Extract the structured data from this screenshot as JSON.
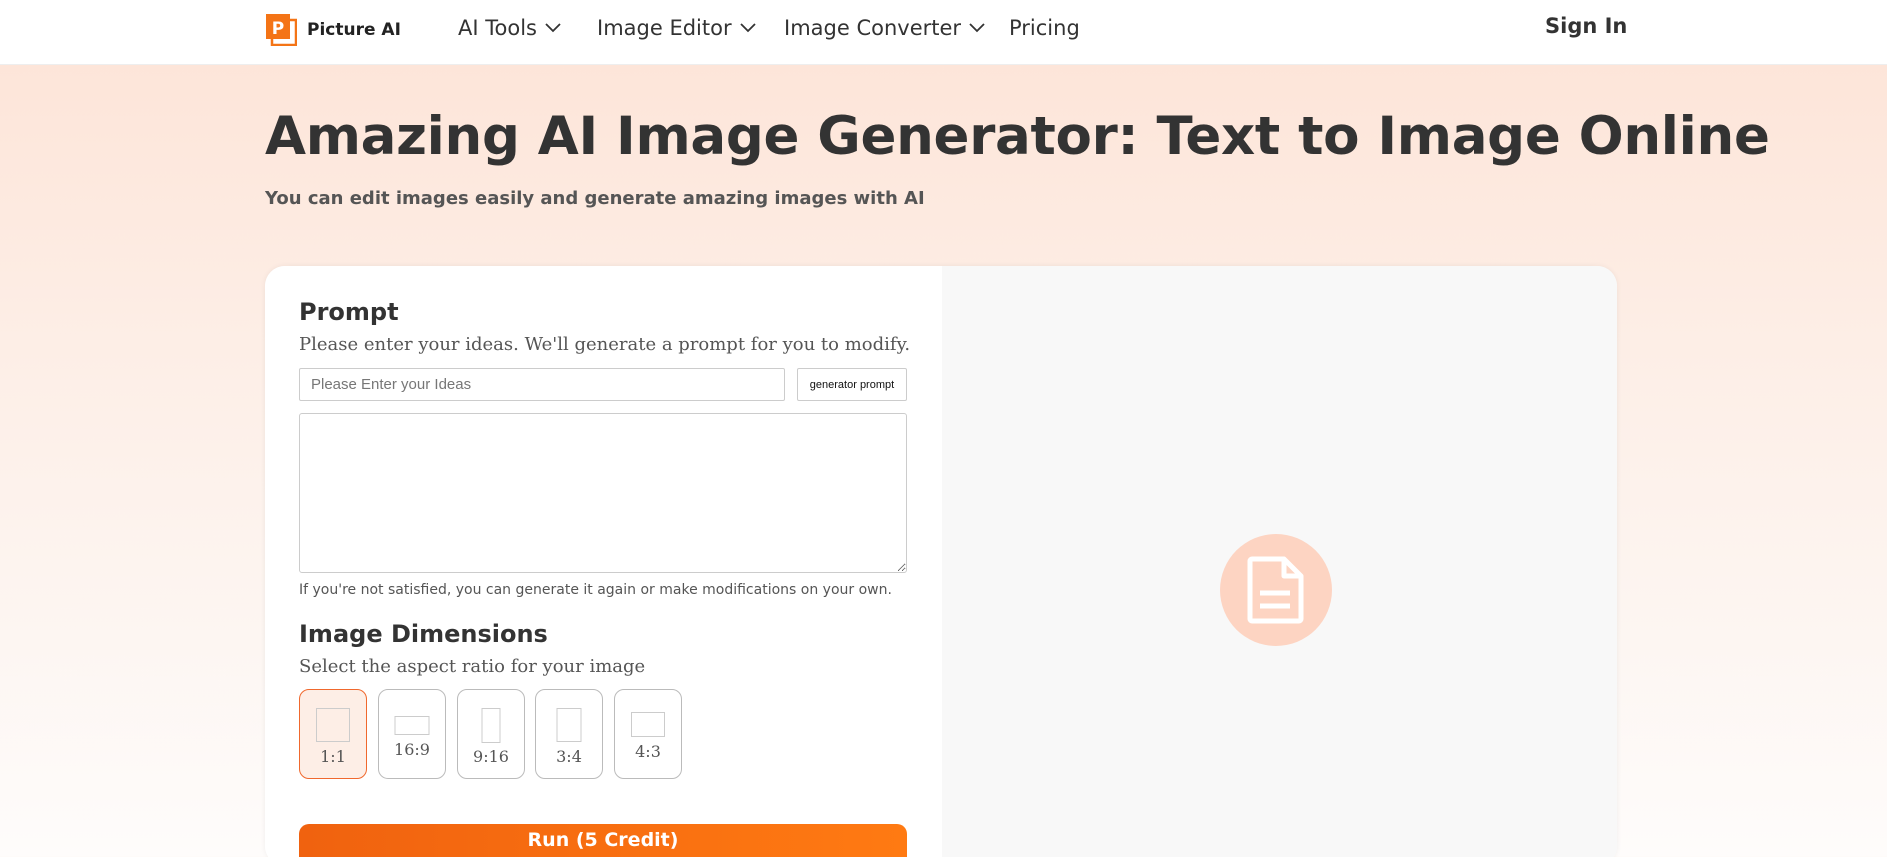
{
  "nav": {
    "brand": "Picture AI",
    "items": [
      {
        "label": "AI Tools",
        "has_dropdown": true
      },
      {
        "label": "Image Editor",
        "has_dropdown": true
      },
      {
        "label": "Image Converter",
        "has_dropdown": true
      },
      {
        "label": "Pricing",
        "has_dropdown": false
      }
    ],
    "sign_in": "Sign In"
  },
  "hero": {
    "title": "Amazing AI Image Generator: Text to Image Online",
    "subtitle": "You can edit images easily and generate amazing images with AI"
  },
  "prompt": {
    "title": "Prompt",
    "description": "Please enter your ideas. We'll generate a prompt for you to modify.",
    "ideas_placeholder": "Please Enter your Ideas",
    "ideas_value": "",
    "generator_button": "generator prompt",
    "prompt_value": "",
    "hint": "If you're not satisfied, you can generate it again or make modifications on your own."
  },
  "dimensions": {
    "title": "Image Dimensions",
    "description": "Select the aspect ratio for your image",
    "options": [
      {
        "label": "1:1",
        "selected": true
      },
      {
        "label": "16:9",
        "selected": false
      },
      {
        "label": "9:16",
        "selected": false
      },
      {
        "label": "3:4",
        "selected": false
      },
      {
        "label": "4:3",
        "selected": false
      }
    ]
  },
  "run_button": "Run (5 Credit)",
  "preview": {
    "icon": "document-icon"
  },
  "colors": {
    "accent": "#f0682d",
    "button": "#ff7a12",
    "placeholder_circle": "#fdd4c2"
  }
}
